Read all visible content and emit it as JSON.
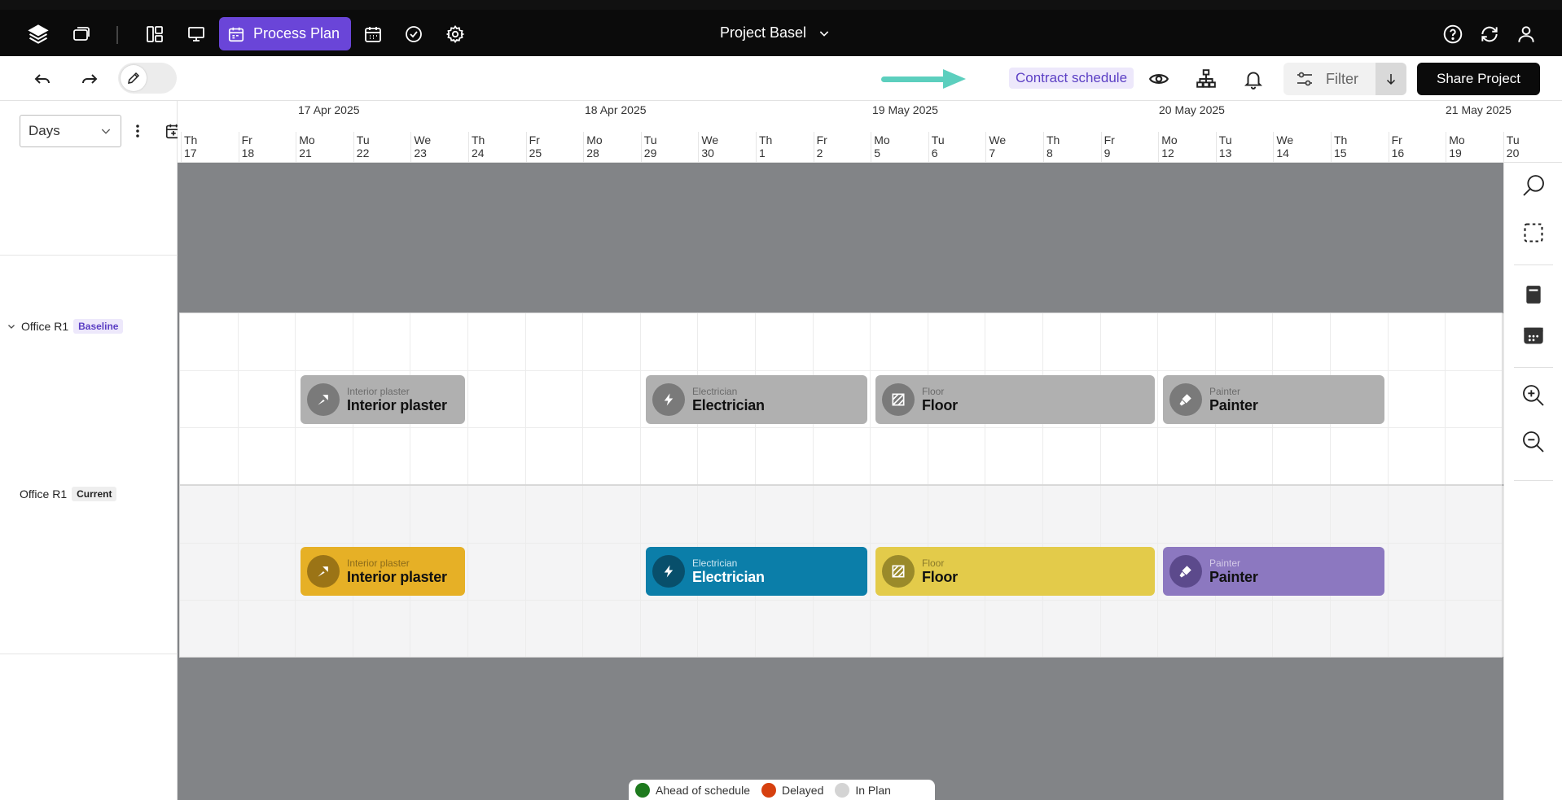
{
  "topbar": {
    "process_plan_label": "Process Plan",
    "project_name": "Project Basel",
    "icons": [
      "layers-icon",
      "folders-icon",
      "layout-icon",
      "presentation-icon",
      "calendar-icon",
      "calendar-grid-icon",
      "check-circle-icon",
      "gear-icon",
      "help-icon",
      "refresh-icon",
      "user-icon"
    ]
  },
  "toolbar": {
    "contract_schedule_label": "Contract schedule",
    "filter_label": "Filter",
    "share_label": "Share Project"
  },
  "left": {
    "view_select_value": "Days",
    "rows": [
      {
        "name": "Office R1",
        "badge": "Baseline"
      },
      {
        "name": "Office R1",
        "badge": "Current"
      }
    ]
  },
  "timeline": {
    "weeks": [
      "17 Apr 2025",
      "18 Apr 2025",
      "19 May 2025",
      "20 May 2025",
      "21 May 2025"
    ],
    "days": [
      {
        "dow": "Th",
        "num": "17"
      },
      {
        "dow": "Fr",
        "num": "18"
      },
      {
        "dow": "Mo",
        "num": "21"
      },
      {
        "dow": "Tu",
        "num": "22"
      },
      {
        "dow": "We",
        "num": "23"
      },
      {
        "dow": "Th",
        "num": "24"
      },
      {
        "dow": "Fr",
        "num": "25"
      },
      {
        "dow": "Mo",
        "num": "28"
      },
      {
        "dow": "Tu",
        "num": "29"
      },
      {
        "dow": "We",
        "num": "30"
      },
      {
        "dow": "Th",
        "num": "1"
      },
      {
        "dow": "Fr",
        "num": "2"
      },
      {
        "dow": "Mo",
        "num": "5"
      },
      {
        "dow": "Tu",
        "num": "6"
      },
      {
        "dow": "We",
        "num": "7"
      },
      {
        "dow": "Th",
        "num": "8"
      },
      {
        "dow": "Fr",
        "num": "9"
      },
      {
        "dow": "Mo",
        "num": "12"
      },
      {
        "dow": "Tu",
        "num": "13"
      },
      {
        "dow": "We",
        "num": "14"
      },
      {
        "dow": "Th",
        "num": "15"
      },
      {
        "dow": "Fr",
        "num": "16"
      },
      {
        "dow": "Mo",
        "num": "19"
      },
      {
        "dow": "Tu",
        "num": "20"
      }
    ]
  },
  "baseline_tasks": [
    {
      "sub": "Interior plaster",
      "title": "Interior plaster",
      "icon": "trowel-icon"
    },
    {
      "sub": "Electrician",
      "title": "Electrician",
      "icon": "lightning-icon"
    },
    {
      "sub": "Floor",
      "title": "Floor",
      "icon": "floor-tiles-icon"
    },
    {
      "sub": "Painter",
      "title": "Painter",
      "icon": "paint-brush-icon"
    }
  ],
  "current_tasks": [
    {
      "sub": "Interior plaster",
      "title": "Interior plaster",
      "icon": "trowel-icon",
      "color": "#e6b026"
    },
    {
      "sub": "Electrician",
      "title": "Electrician",
      "icon": "lightning-icon",
      "color": "#0b7ea9"
    },
    {
      "sub": "Floor",
      "title": "Floor",
      "icon": "floor-tiles-icon",
      "color": "#e3cb4a"
    },
    {
      "sub": "Painter",
      "title": "Painter",
      "icon": "paint-brush-icon",
      "color": "#8c78c0"
    }
  ],
  "legend": [
    {
      "label": "Ahead of schedule",
      "color": "#1e7a1e"
    },
    {
      "label": "Delayed",
      "color": "#d6400f"
    },
    {
      "label": "In Plan",
      "color": "#d4d4d4"
    }
  ],
  "colors": {
    "accent": "#6a45d8",
    "baseline_task": "#b0b0b0",
    "canvas_gray": "#828487",
    "arrow": "#5ccfbe"
  }
}
